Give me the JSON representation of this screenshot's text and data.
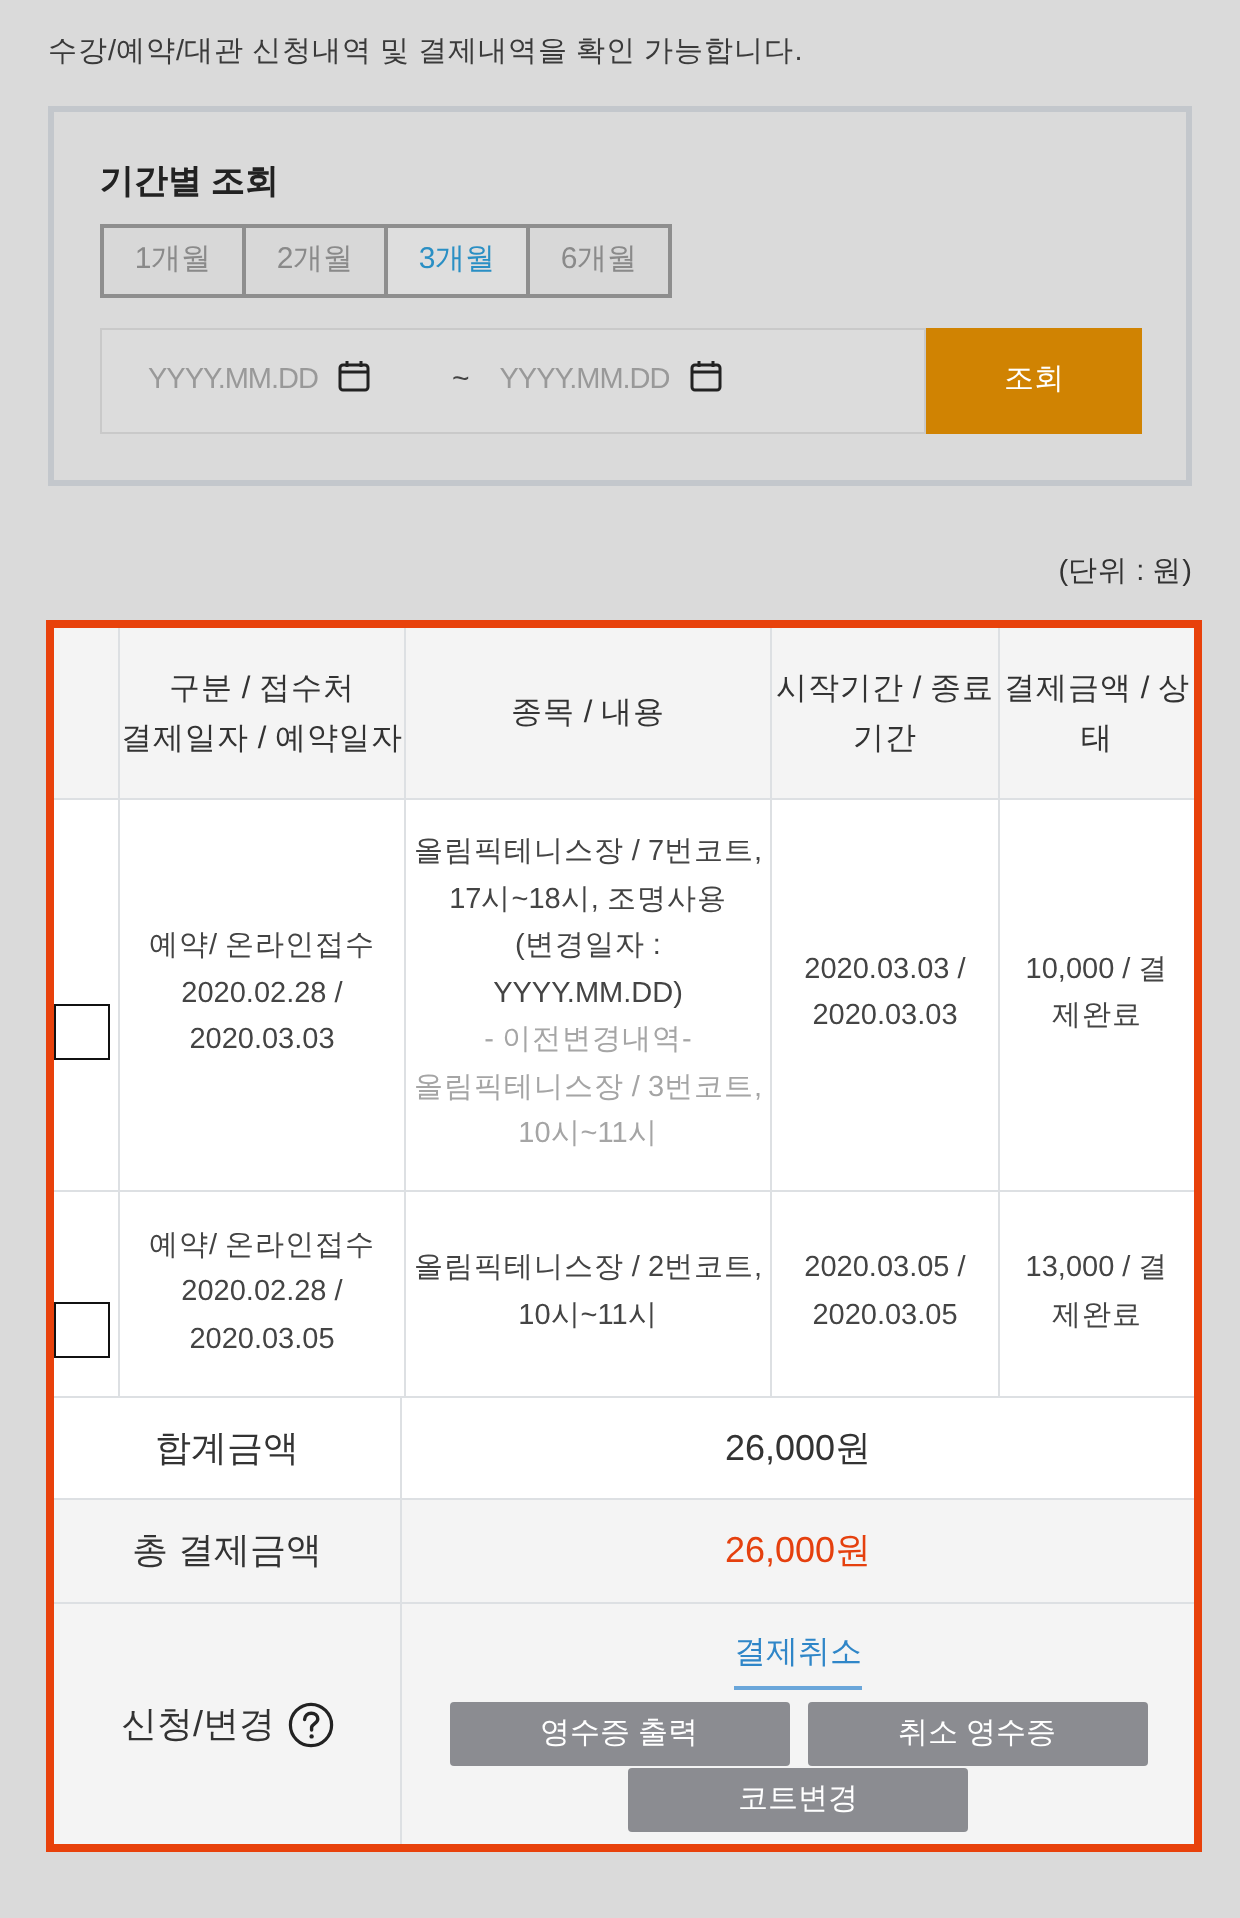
{
  "intro": "수강/예약/대관 신청내역 및 결제내역을 확인 가능합니다.",
  "filter": {
    "title": "기간별 조회",
    "periods": [
      {
        "label": "1개월",
        "selected": false
      },
      {
        "label": "2개월",
        "selected": false
      },
      {
        "label": "3개월",
        "selected": true
      },
      {
        "label": "6개월",
        "selected": false
      }
    ],
    "date_from": {
      "placeholder": "YYYY.MM.DD"
    },
    "separator": "~",
    "date_to": {
      "placeholder": "YYYY.MM.DD"
    },
    "search_button": "조회"
  },
  "unit_note": "(단위 : 원)",
  "table": {
    "columns": [
      "구분 / 접수처\n결제일자 / 예약일자",
      "종목 / 내용",
      "시작기간 / 종료\n기간",
      "결제금액 / 상\n태"
    ],
    "rows": [
      {
        "checked": false,
        "category_date": "예약/ 온라인접수\n2020.02.28 /\n2020.03.03",
        "content": "올림픽테니스장 / 7번코트,\n17시~18시, 조명사용\n(변경일자 :\nYYYY.MM.DD)",
        "previous": "- 이전변경내역-\n올림픽테니스장 / 3번코트,\n10시~11시",
        "period": "2020.03.03 /\n2020.03.03",
        "amount_status": "10,000 / 결\n제완료"
      },
      {
        "checked": false,
        "category_date": "예약/ 온라인접수\n2020.02.28 /\n2020.03.05",
        "content": "올림픽테니스장 / 2번코트,\n10시~11시",
        "period": "2020.03.05 /\n2020.03.05",
        "amount_status": "13,000 / 결\n제완료"
      }
    ]
  },
  "summary": {
    "subtotal": {
      "label": "합계금액",
      "value": "26,000원"
    },
    "total": {
      "label": "총 결제금액",
      "value": "26,000원"
    },
    "actions": {
      "label": "신청/변경",
      "link": "결제취소",
      "buttons": [
        "영수증 출력",
        "취소 영수증",
        "코트변경"
      ]
    }
  }
}
